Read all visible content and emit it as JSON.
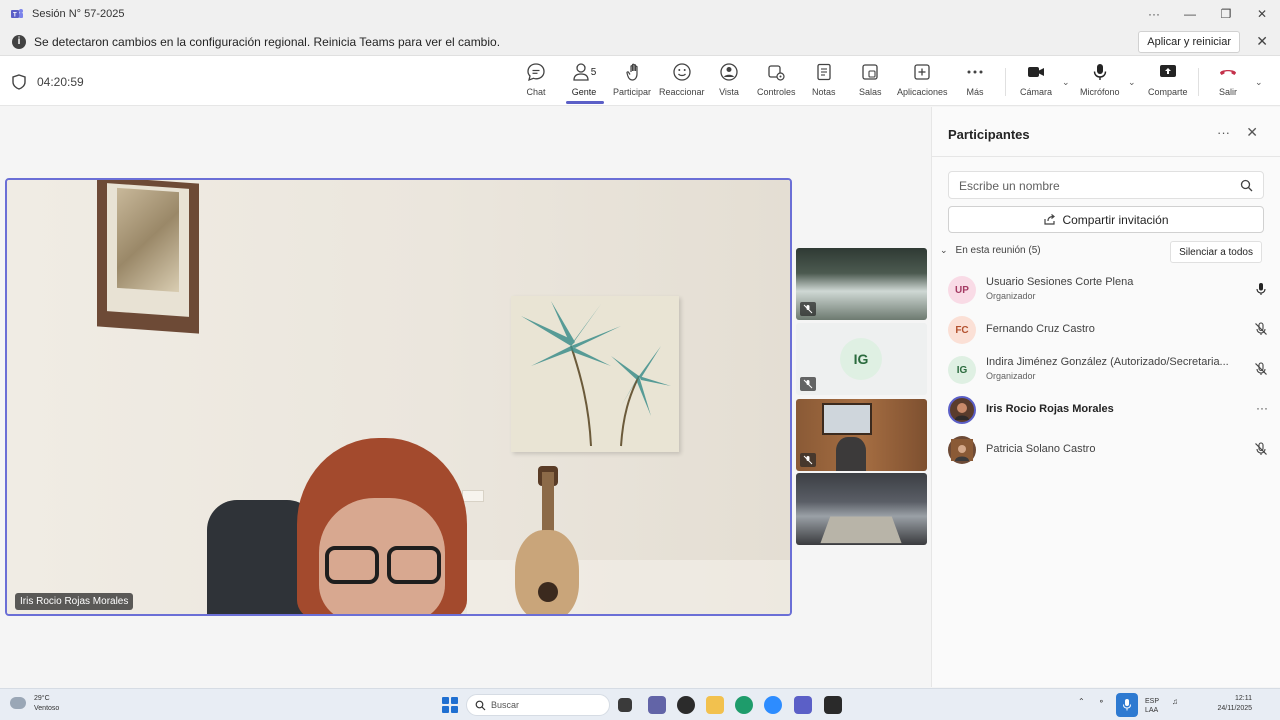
{
  "window": {
    "title": "Sesión N° 57-2025"
  },
  "notification": {
    "message": "Se detectaron cambios en la configuración regional. Reinicia Teams para ver el cambio.",
    "action_label": "Aplicar y reiniciar"
  },
  "meeting": {
    "timer": "04:20:59",
    "people_count": "5"
  },
  "toolbar": {
    "chat": "Chat",
    "people": "Gente",
    "raise": "Participar",
    "react": "Reaccionar",
    "view": "Vista",
    "controls": "Controles",
    "notes": "Notas",
    "rooms": "Salas",
    "apps": "Aplicaciones",
    "more": "Más",
    "camera": "Cámara",
    "mic": "Micrófono",
    "share": "Comparte",
    "leave": "Salir"
  },
  "main_video": {
    "name": "Iris Rocio Rojas Morales"
  },
  "thumbnails": [
    {
      "initials": ""
    },
    {
      "initials": "IG"
    },
    {
      "initials": ""
    },
    {
      "initials": ""
    }
  ],
  "panel": {
    "title": "Participantes",
    "search_placeholder": "Escribe un nombre",
    "invite_label": "Compartir invitación",
    "section_label": "En esta reunión (5)",
    "mute_all_label": "Silenciar a todos",
    "participants": [
      {
        "initials": "UP",
        "name": "Usuario Sesiones Corte Plena",
        "role": "Organizador",
        "status": "mic-on"
      },
      {
        "initials": "FC",
        "name": "Fernando Cruz Castro",
        "role": "",
        "status": "mic-off"
      },
      {
        "initials": "IG",
        "name": "Indira Jiménez González (Autorizado/Secretaria...",
        "role": "Organizador",
        "status": "mic-off"
      },
      {
        "initials": "",
        "name": "Iris Rocio Rojas Morales",
        "role": "",
        "status": "more"
      },
      {
        "initials": "",
        "name": "Patricia Solano Castro",
        "role": "",
        "status": "mic-off"
      }
    ]
  },
  "taskbar": {
    "temp": "29°C",
    "weather": "Ventoso",
    "search": "Buscar",
    "lang1": "ESP",
    "lang2": "LAA",
    "time": "12:11",
    "date": "24/11/2025"
  },
  "colors": {
    "accent": "#5b5fc7",
    "leave": "#c4314b",
    "speaking_border": "#6b6fd6"
  }
}
